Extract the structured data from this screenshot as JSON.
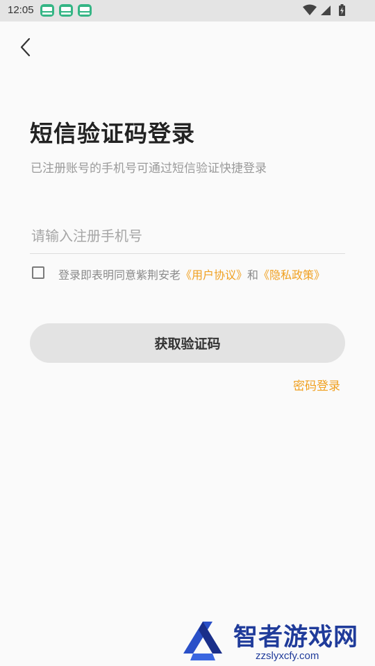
{
  "status_bar": {
    "time": "12:05",
    "notification_icons": [
      "app-notification-icon",
      "app-notification-icon",
      "app-notification-icon"
    ],
    "system_icons": [
      "wifi-icon",
      "signal-icon",
      "battery-charging-icon"
    ]
  },
  "header": {
    "back_icon": "chevron-left-icon"
  },
  "main": {
    "title": "短信验证码登录",
    "subtitle": "已注册账号的手机号可通过短信验证快捷登录",
    "phone_input": {
      "value": "",
      "placeholder": "请输入注册手机号"
    },
    "agreement": {
      "checked": false,
      "prefix": "登录即表明同意紫荆安老",
      "user_agreement_link": "《用户协议》",
      "conjunction": "和",
      "privacy_policy_link": "《隐私政策》"
    },
    "get_code_button": "获取验证码",
    "password_login_link": "密码登录"
  },
  "watermark": {
    "title": "智者游戏网",
    "url": "zzslyxcfy.com"
  },
  "colors": {
    "background": "#fafafa",
    "status_bar": "#e4e4e4",
    "accent": "#f0a020",
    "button_bg": "#e3e3e3",
    "text_primary": "#222222",
    "text_secondary": "#9a9a9a",
    "watermark": "#1f3b9a"
  }
}
